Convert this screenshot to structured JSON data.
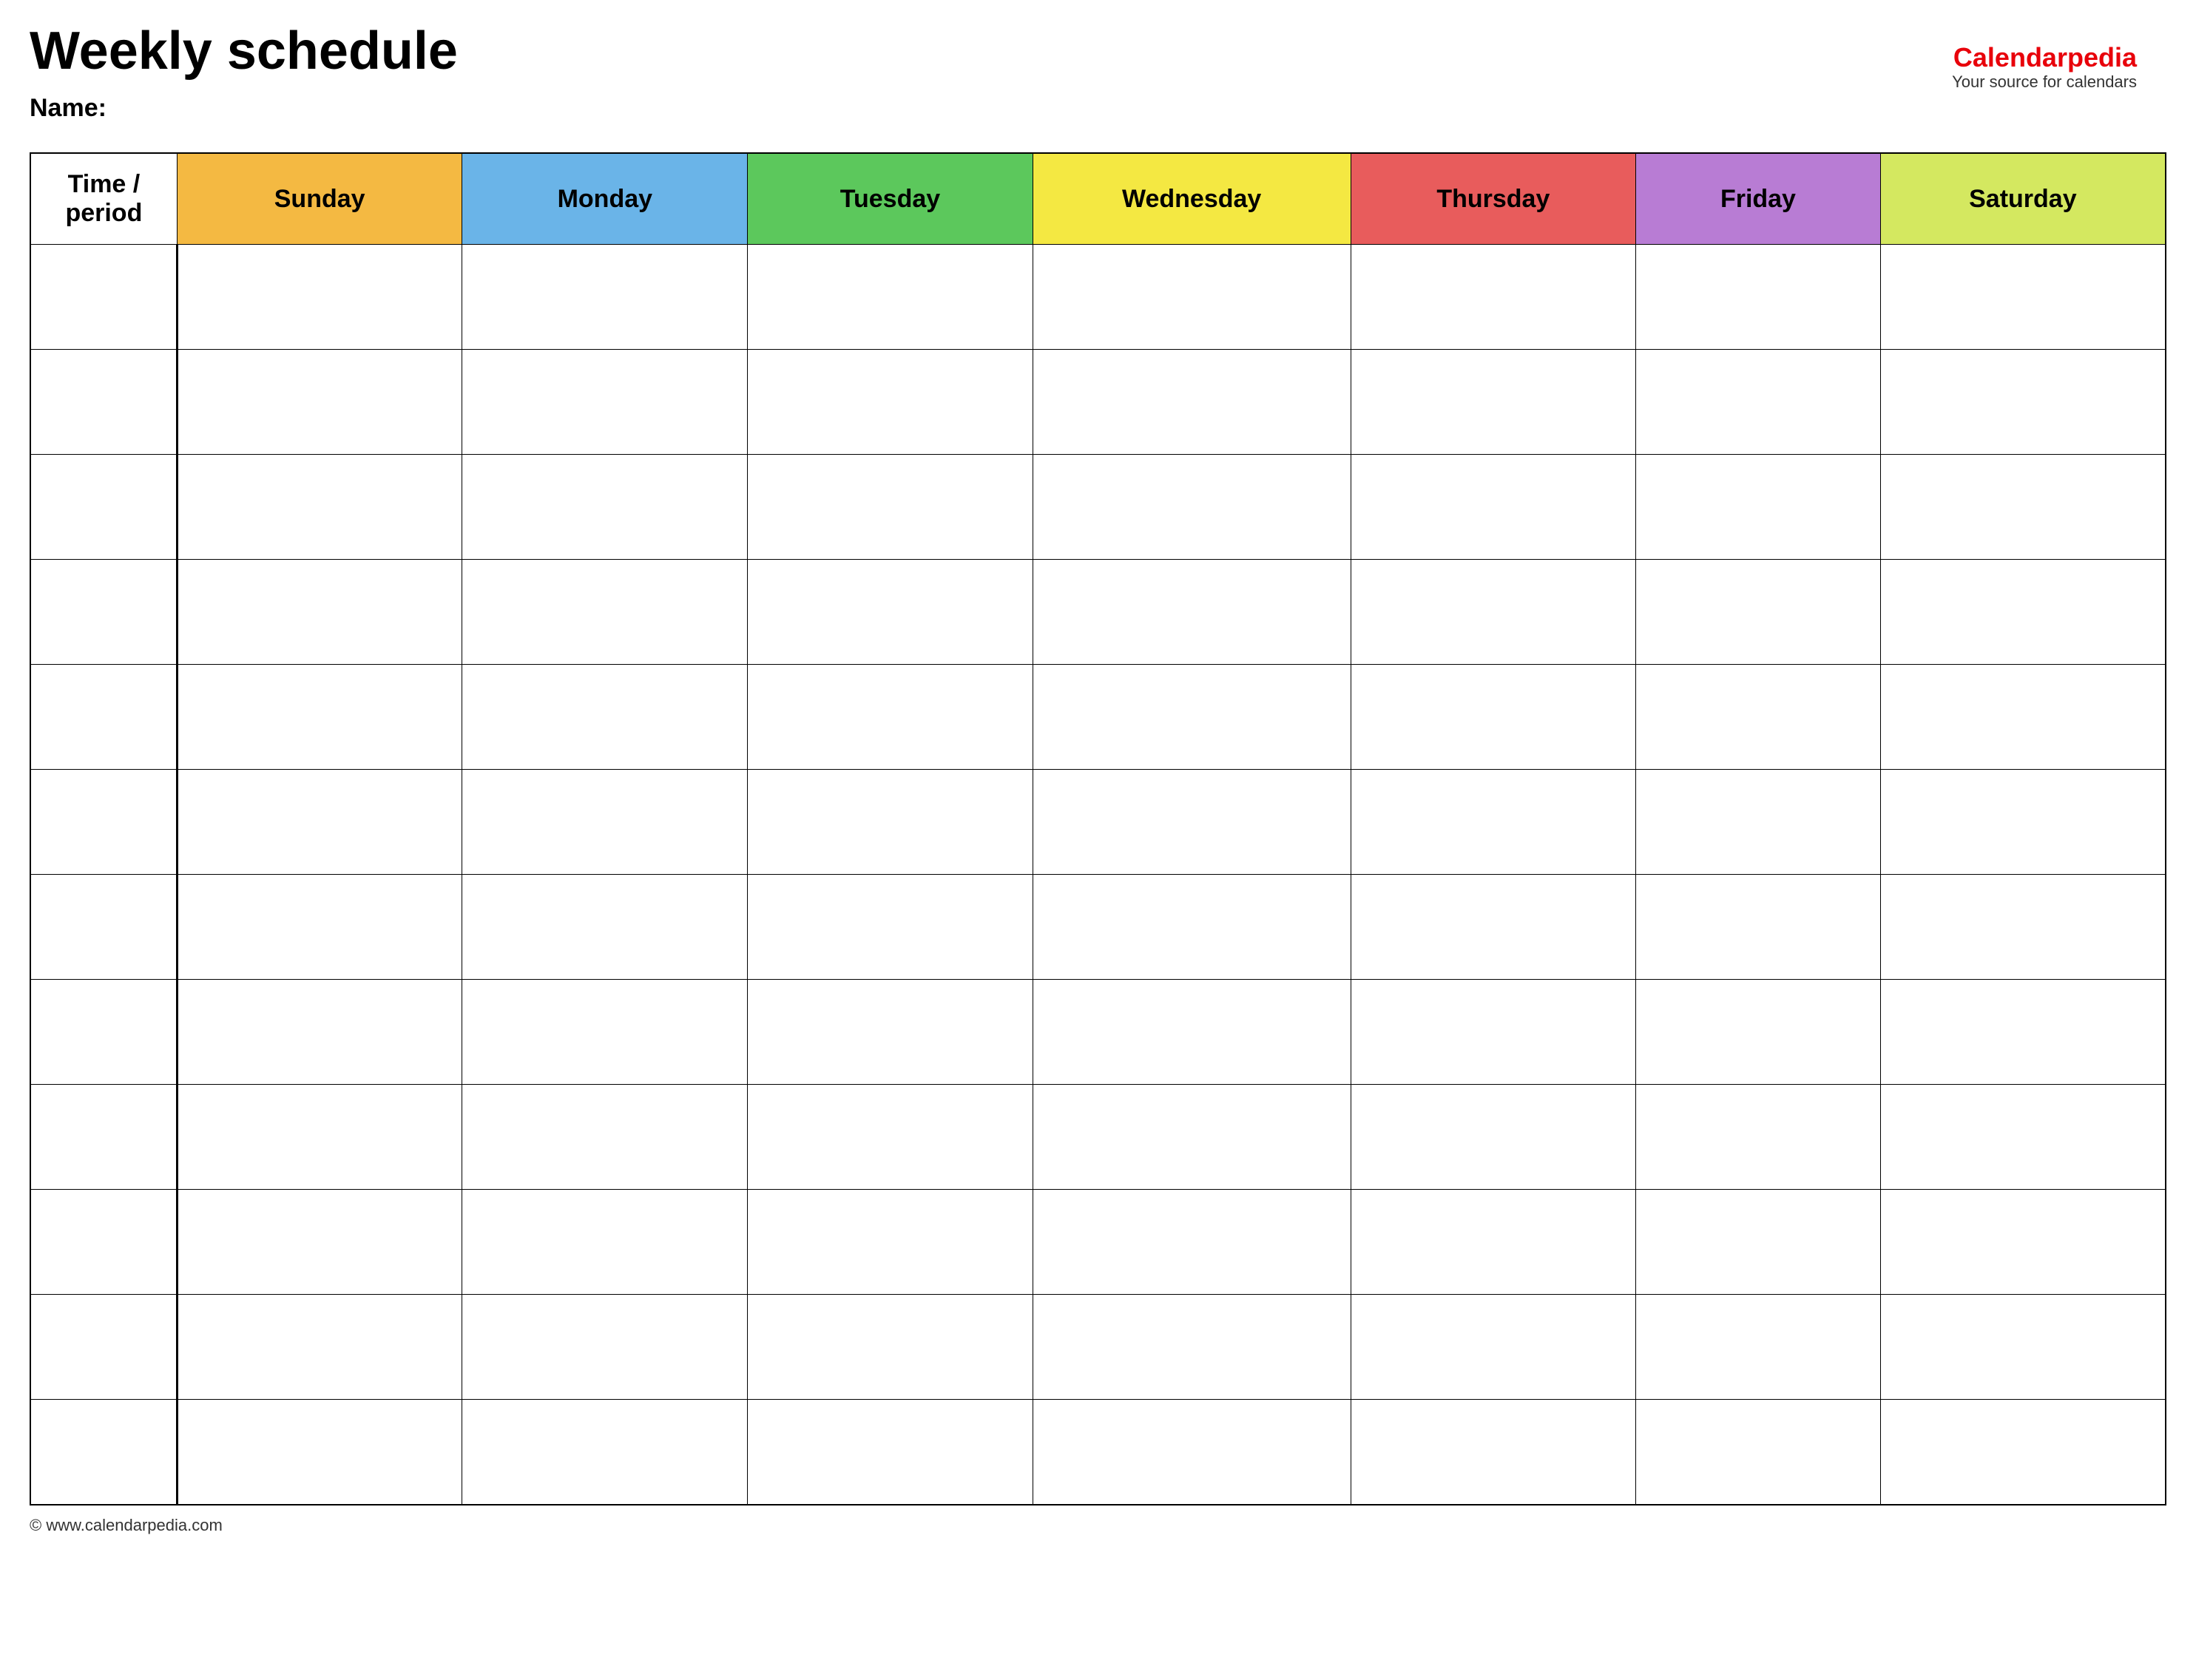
{
  "page": {
    "title": "Weekly schedule",
    "name_label": "Name:",
    "footer_url": "© www.calendarpedia.com"
  },
  "brand": {
    "name_part1": "Calendar",
    "name_part2": "pedia",
    "tagline": "Your source for calendars"
  },
  "table": {
    "headers": [
      {
        "id": "time",
        "label": "Time / period",
        "color": "#ffffff"
      },
      {
        "id": "sunday",
        "label": "Sunday",
        "color": "#f4b942"
      },
      {
        "id": "monday",
        "label": "Monday",
        "color": "#6ab4e8"
      },
      {
        "id": "tuesday",
        "label": "Tuesday",
        "color": "#5cc85c"
      },
      {
        "id": "wednesday",
        "label": "Wednesday",
        "color": "#f4e842"
      },
      {
        "id": "thursday",
        "label": "Thursday",
        "color": "#e85c5c"
      },
      {
        "id": "friday",
        "label": "Friday",
        "color": "#b87cd4"
      },
      {
        "id": "saturday",
        "label": "Saturday",
        "color": "#d4e860"
      }
    ],
    "row_count": 12
  }
}
